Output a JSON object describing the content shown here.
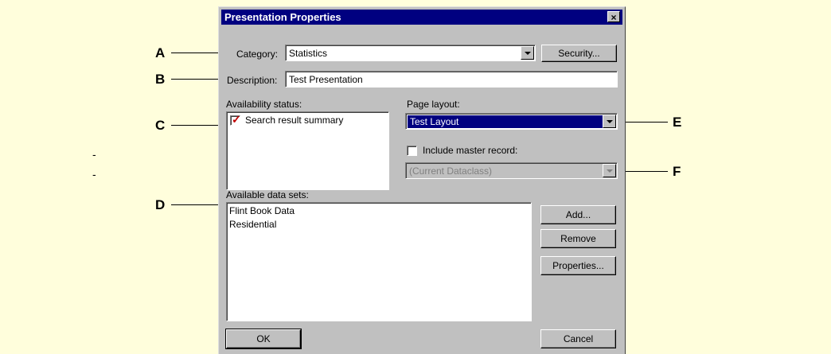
{
  "callouts": [
    "A",
    "B",
    "C",
    "D",
    "E",
    "F"
  ],
  "dashes": [
    "-",
    "-"
  ],
  "dialog": {
    "title": "Presentation Properties",
    "close_glyph": "×",
    "category_label": "Category:",
    "category_value": "Statistics",
    "security_button": "Security...",
    "description_label": "Description:",
    "description_value": "Test Presentation",
    "availability_label": "Availability status:",
    "availability_items": [
      {
        "label": "Search result summary",
        "checked": true
      }
    ],
    "page_layout_label": "Page layout:",
    "page_layout_value": "Test Layout",
    "include_master_label": "Include master record:",
    "include_master_checked": false,
    "master_dataclass_value": "(Current Dataclass)",
    "datasets_label": "Available data sets:",
    "datasets": [
      "Flint Book Data",
      "Residential"
    ],
    "add_button": "Add...",
    "remove_button": "Remove",
    "properties_button": "Properties...",
    "ok_button": "OK",
    "cancel_button": "Cancel"
  },
  "icons": {
    "check": "check-icon",
    "dropdown": "chevron-down-icon",
    "close": "close-icon"
  },
  "colors": {
    "background": "#fffedc",
    "titlebar": "#000080",
    "dialog": "#c0c0c0",
    "check": "#c00000"
  }
}
